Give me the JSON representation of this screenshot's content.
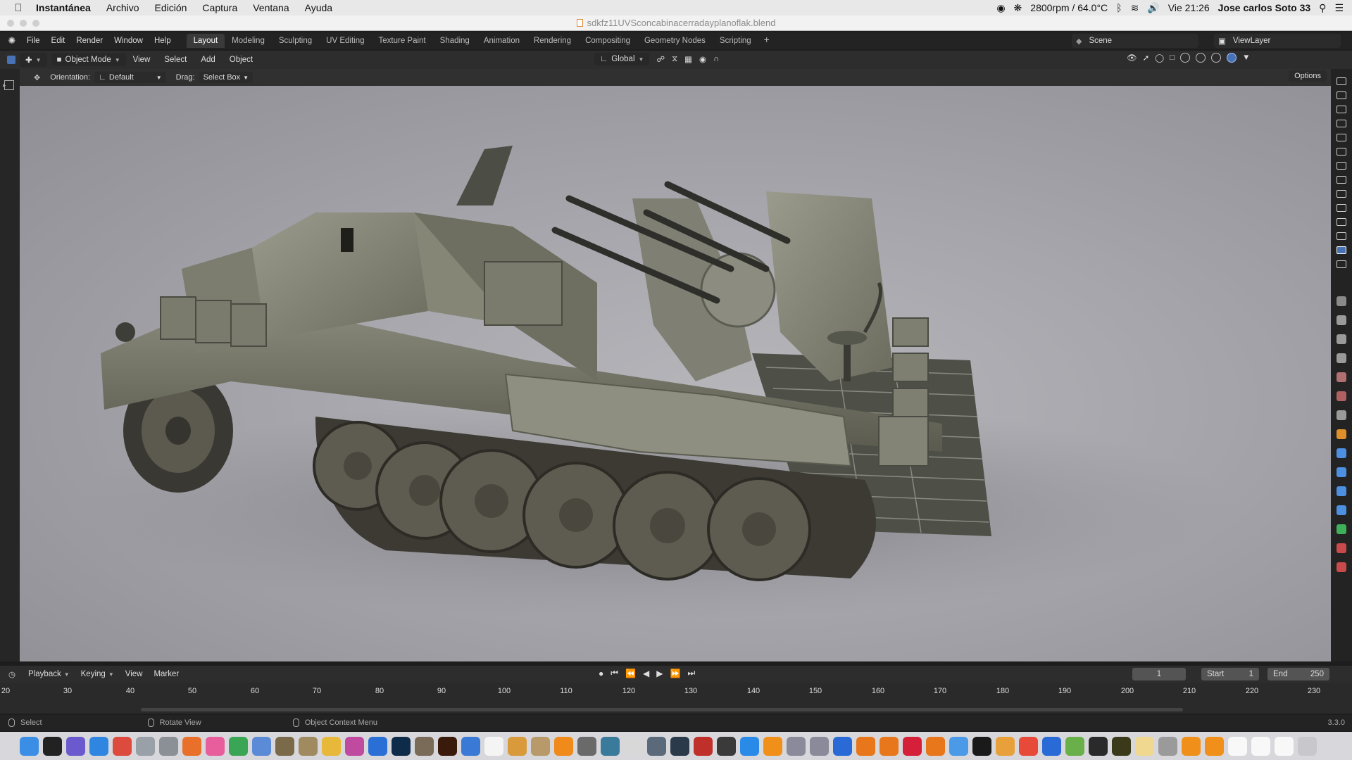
{
  "mac_menubar": {
    "app_name": "Instantánea",
    "menus": [
      "Archivo",
      "Edición",
      "Captura",
      "Ventana",
      "Ayuda"
    ],
    "fan_temp": "2800rpm / 64.0°C",
    "clock": "Vie 21:26",
    "user": "Jose carlos Soto 33"
  },
  "window": {
    "title": "sdkfz11UVSconcabinacerradayplanoflak.blend"
  },
  "blender_topbar": {
    "menus": [
      "File",
      "Edit",
      "Render",
      "Window",
      "Help"
    ],
    "workspaces": [
      "Layout",
      "Modeling",
      "Sculpting",
      "UV Editing",
      "Texture Paint",
      "Shading",
      "Animation",
      "Rendering",
      "Compositing",
      "Geometry Nodes",
      "Scripting"
    ],
    "active_workspace": "Layout",
    "add_workspace": "+",
    "scene": "Scene",
    "view_layer": "ViewLayer"
  },
  "viewport_header": {
    "mode": "Object Mode",
    "menus": [
      "View",
      "Select",
      "Add",
      "Object"
    ],
    "transform_orientation": "Global"
  },
  "tool_settings": {
    "orientation_label": "Orientation:",
    "orientation_value": "Default",
    "drag_label": "Drag:",
    "drag_value": "Select Box",
    "options": "Options"
  },
  "timeline": {
    "menus": [
      "Playback",
      "Keying",
      "View",
      "Marker"
    ],
    "current_frame": "1",
    "start_label": "Start",
    "start_value": "1",
    "end_label": "End",
    "end_value": "250",
    "ruler_ticks": [
      "20",
      "30",
      "40",
      "50",
      "60",
      "70",
      "80",
      "90",
      "100",
      "110",
      "120",
      "130",
      "140",
      "150",
      "160",
      "170",
      "180",
      "190",
      "200",
      "210",
      "220",
      "230"
    ]
  },
  "status_bar": {
    "select": "Select",
    "rotate": "Rotate View",
    "context_menu": "Object Context Menu",
    "version": "3.3.0"
  },
  "colors": {
    "accent": "#4772b3",
    "viewport_bg": "#a5a5ab"
  },
  "dock_apps": [
    "finder",
    "terminal",
    "siri",
    "safari",
    "chrome",
    "preview",
    "launchpad",
    "firefox",
    "itunes",
    "utorrent",
    "mail",
    "photos",
    "notes",
    "sketch",
    "affinity",
    "xcode",
    "photoshop",
    "gimp",
    "illustrator",
    "network",
    "textedit",
    "finder-2",
    "archive",
    "vlc",
    "settings",
    "facetime",
    "mail-2",
    "screen",
    "quicktime",
    "pencil",
    "photo-booth",
    "appstore",
    "books",
    "fusion",
    "fusion-2",
    "blender",
    "blender-2",
    "blender-3",
    "blender-4",
    "blender-5",
    "preview-2",
    "daz",
    "office",
    "mixer",
    "bluetooth",
    "android",
    "davinci",
    "resolve",
    "documents",
    "grid",
    "folder-1",
    "folder-2",
    "file-1",
    "file-2",
    "file-3",
    "trash"
  ]
}
